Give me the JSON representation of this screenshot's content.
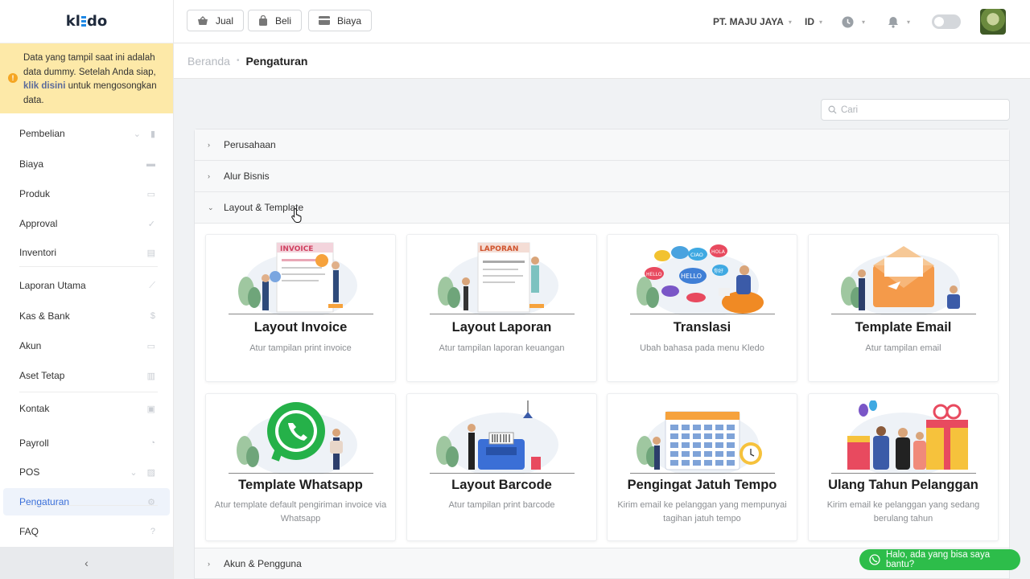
{
  "app": {
    "logo": "kl=do"
  },
  "notice": {
    "text_before": "Data yang tampil saat ini adalah data dummy. Setelah Anda siap, ",
    "link": "klik disini",
    "text_after": " untuk mengosongkan data."
  },
  "sidebar": {
    "items": [
      {
        "label": "Pembelian",
        "icon": "bag-icon",
        "expandable": true
      },
      {
        "label": "Biaya",
        "icon": "card-icon"
      },
      {
        "label": "Produk",
        "icon": "box-icon"
      },
      {
        "label": "Approval",
        "icon": "check-icon"
      },
      {
        "label": "Inventori",
        "icon": "warehouse-icon"
      },
      {
        "label": "Laporan Utama",
        "icon": "chart-icon"
      },
      {
        "label": "Kas & Bank",
        "icon": "dollar-icon"
      },
      {
        "label": "Akun",
        "icon": "book-icon"
      },
      {
        "label": "Aset Tetap",
        "icon": "building-icon"
      },
      {
        "label": "Kontak",
        "icon": "contact-card-icon"
      },
      {
        "label": "Payroll",
        "icon": "payroll-icon"
      },
      {
        "label": "POS",
        "icon": "pos-icon",
        "expandable": true
      },
      {
        "label": "Pengaturan",
        "icon": "gears-icon",
        "active": true
      },
      {
        "label": "FAQ",
        "icon": "question-icon"
      }
    ],
    "collapse_label": "‹"
  },
  "topbar": {
    "buttons": [
      {
        "label": "Jual",
        "icon": "basket-icon"
      },
      {
        "label": "Beli",
        "icon": "bag-icon"
      },
      {
        "label": "Biaya",
        "icon": "card-icon"
      }
    ],
    "company": "PT. MAJU JAYA",
    "language": "ID"
  },
  "breadcrumb": {
    "home": "Beranda",
    "current": "Pengaturan"
  },
  "search": {
    "placeholder": "Cari"
  },
  "accordion": [
    {
      "label": "Perusahaan",
      "expanded": false
    },
    {
      "label": "Alur Bisnis",
      "expanded": false
    },
    {
      "label": "Layout & Template",
      "expanded": true
    },
    {
      "label": "Akun & Pengguna",
      "expanded": false
    }
  ],
  "cards": [
    {
      "title": "Layout Invoice",
      "desc": "Atur tampilan print invoice",
      "illus": "invoice"
    },
    {
      "title": "Layout Laporan",
      "desc": "Atur tampilan laporan keuangan",
      "illus": "report"
    },
    {
      "title": "Translasi",
      "desc": "Ubah bahasa pada menu Kledo",
      "illus": "translate"
    },
    {
      "title": "Template Email",
      "desc": "Atur tampilan email",
      "illus": "email"
    },
    {
      "title": "Template Whatsapp",
      "desc": "Atur template default pengiriman invoice via Whatsapp",
      "illus": "whatsapp"
    },
    {
      "title": "Layout Barcode",
      "desc": "Atur tampilan print barcode",
      "illus": "barcode"
    },
    {
      "title": "Pengingat Jatuh Tempo",
      "desc": "Kirim email ke pelanggan yang mempunyai tagihan jatuh tempo",
      "illus": "calendar"
    },
    {
      "title": "Ulang Tahun Pelanggan",
      "desc": "Kirim email ke pelanggan yang sedang berulang tahun",
      "illus": "birthday"
    }
  ],
  "illustration_text": {
    "invoice": "INVOICE",
    "report": "LAPORAN",
    "bubbles": [
      "HELLO",
      "CIAO",
      "HOLA",
      "你好",
      "HELLO",
      "你好"
    ]
  },
  "chat_button": {
    "label": "Halo, ada yang bisa saya bantu?"
  },
  "colors": {
    "accent": "#3a6fd8",
    "notice_bg": "#fde9a8",
    "whatsapp": "#2dbd4a"
  }
}
